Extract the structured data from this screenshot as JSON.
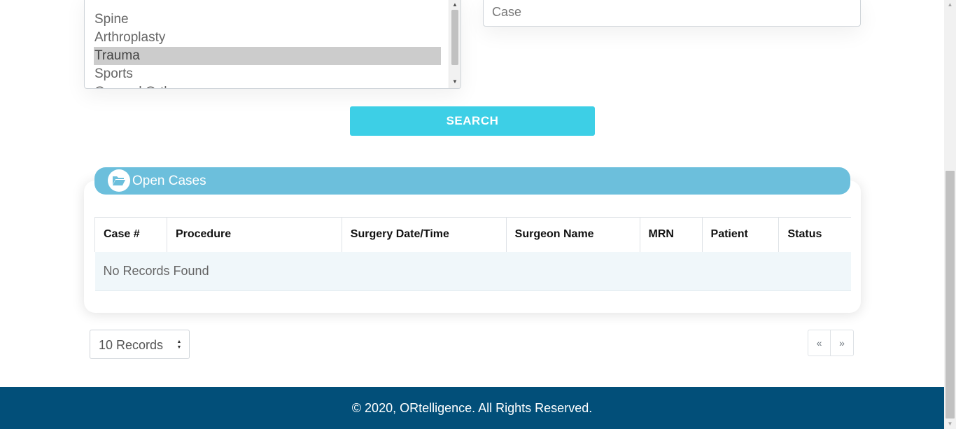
{
  "specialty_list": {
    "items": [
      {
        "label": "Spine",
        "selected": false
      },
      {
        "label": "Arthroplasty",
        "selected": false
      },
      {
        "label": "Trauma",
        "selected": true
      },
      {
        "label": "Sports",
        "selected": false
      },
      {
        "label": "General Orth",
        "selected": false
      }
    ]
  },
  "case_field": {
    "placeholder": "Case",
    "value": ""
  },
  "search_button": {
    "label": "SEARCH"
  },
  "open_cases": {
    "title": "Open Cases",
    "icon": "folder-open-icon",
    "columns": [
      "Case #",
      "Procedure",
      "Surgery Date/Time",
      "Surgeon Name",
      "MRN",
      "Patient",
      "Status"
    ],
    "empty_message": "No Records Found"
  },
  "records_select": {
    "selected": "10 Records"
  },
  "pagination": {
    "prev": "«",
    "next": "»"
  },
  "footer": {
    "text": "© 2020, ORtelligence. All Rights Reserved."
  },
  "colors": {
    "accent": "#3dcfe6",
    "card_header": "#6cbfdc",
    "footer_bg": "#024f79",
    "selected_item": "#cccccc"
  }
}
